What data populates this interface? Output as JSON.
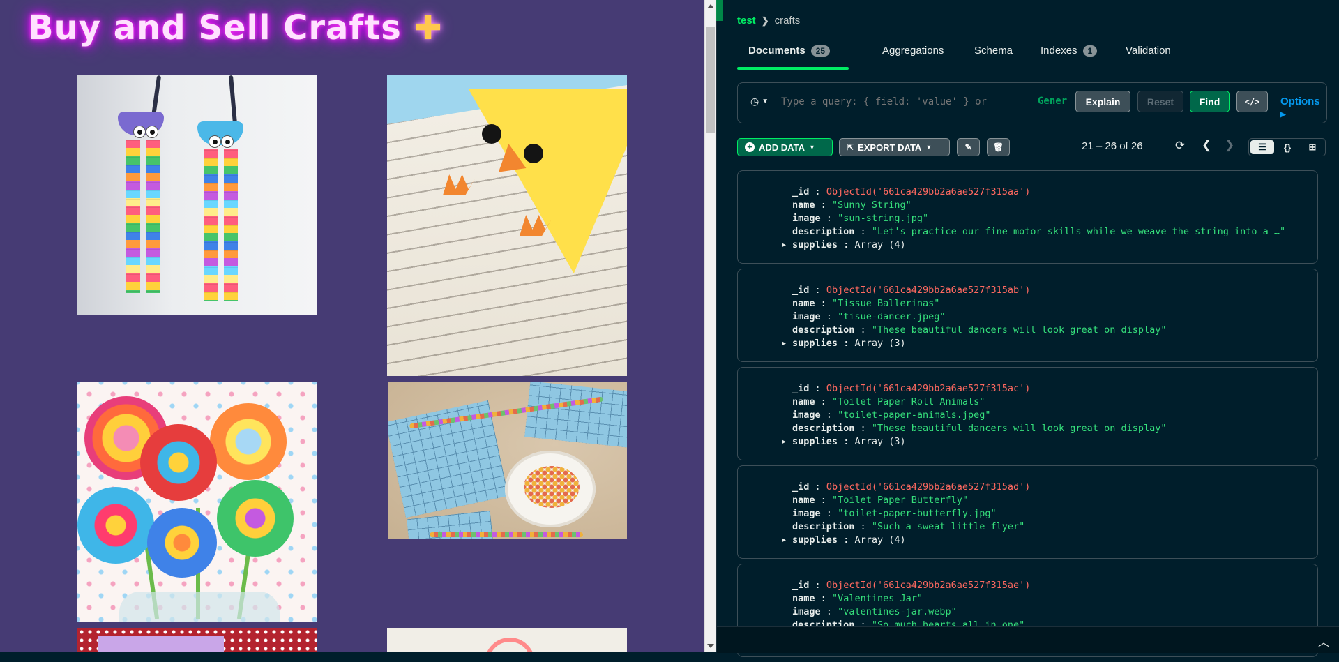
{
  "left_site": {
    "title": "Buy and Sell Crafts",
    "title_sparkle": "✚"
  },
  "compass": {
    "breadcrumb": {
      "database": "test",
      "collection": "crafts"
    },
    "tabs": [
      {
        "label": "Documents",
        "count": "25"
      },
      {
        "label": "Aggregations"
      },
      {
        "label": "Schema"
      },
      {
        "label": "Indexes",
        "count": "1"
      },
      {
        "label": "Validation"
      }
    ],
    "query": {
      "placeholder": "Type a query: { field: 'value' } or",
      "generate_link": "Gener",
      "explain": "Explain",
      "reset": "Reset",
      "find": "Find",
      "code": "</>",
      "options": "Options"
    },
    "toolbar": {
      "add_data": "ADD DATA",
      "export_data": "EXPORT DATA",
      "pager": "21 – 26 of 26"
    },
    "documents": [
      {
        "id": "ObjectId('661ca429bb2a6ae527f315aa')",
        "name": "\"Sunny String\"",
        "image": "\"sun-string.jpg\"",
        "description": "\"Let's practice our fine motor skills while we weave the string into a …\"",
        "supplies": "Array (4)"
      },
      {
        "id": "ObjectId('661ca429bb2a6ae527f315ab')",
        "name": "\"Tissue Ballerinas\"",
        "image": "\"tisue-dancer.jpeg\"",
        "description": "\"These beautiful dancers will look great on display\"",
        "supplies": "Array (3)"
      },
      {
        "id": "ObjectId('661ca429bb2a6ae527f315ac')",
        "name": "\"Toilet Paper Roll Animals\"",
        "image": "\"toilet-paper-animals.jpeg\"",
        "description": "\"These beautiful dancers will look great on display\"",
        "supplies": "Array (3)"
      },
      {
        "id": "ObjectId('661ca429bb2a6ae527f315ad')",
        "name": "\"Toilet Paper Butterfly\"",
        "image": "\"toilet-paper-butterfly.jpg\"",
        "description": "\"Such a sweat little flyer\"",
        "supplies": "Array (4)"
      },
      {
        "id": "ObjectId('661ca429bb2a6ae527f315ae')",
        "name": "\"Valentines Jar\"",
        "image": "\"valentines-jar.webp\"",
        "description": "\"So much hearts all in one\"",
        "supplies": ""
      }
    ],
    "field_labels": {
      "id": "_id",
      "name": "name",
      "image": "image",
      "description": "description",
      "supplies": "supplies",
      "colon": ":"
    }
  }
}
